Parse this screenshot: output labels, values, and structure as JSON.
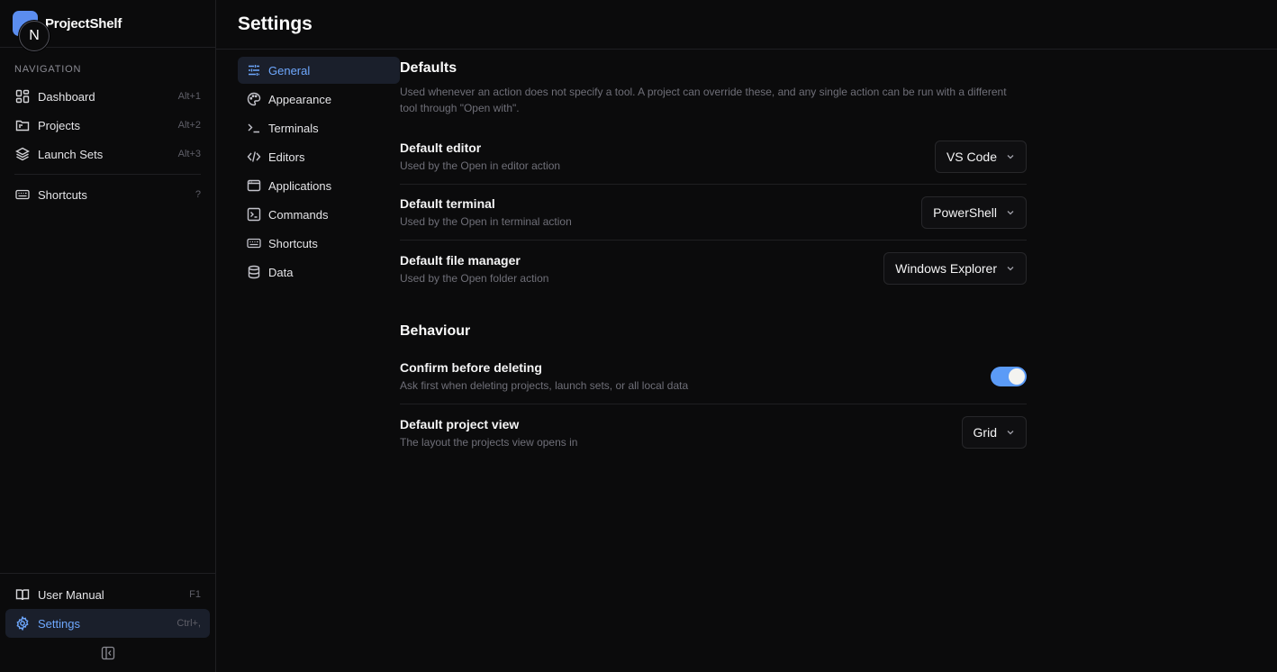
{
  "app": {
    "name": "ProjectShelf",
    "badge": "N"
  },
  "sidebar": {
    "section_label": "NAVIGATION",
    "items": [
      {
        "label": "Dashboard",
        "shortcut": "Alt+1",
        "icon": "dashboard-icon"
      },
      {
        "label": "Projects",
        "shortcut": "Alt+2",
        "icon": "folder-icon"
      },
      {
        "label": "Launch Sets",
        "shortcut": "Alt+3",
        "icon": "layers-icon"
      }
    ],
    "shortcuts_item": {
      "label": "Shortcuts",
      "shortcut": "?"
    },
    "bottom": {
      "manual": {
        "label": "User Manual",
        "shortcut": "F1"
      },
      "settings": {
        "label": "Settings",
        "shortcut": "Ctrl+,"
      }
    }
  },
  "page": {
    "title": "Settings"
  },
  "settings_nav": [
    {
      "label": "General",
      "active": true
    },
    {
      "label": "Appearance"
    },
    {
      "label": "Terminals"
    },
    {
      "label": "Editors"
    },
    {
      "label": "Applications"
    },
    {
      "label": "Commands"
    },
    {
      "label": "Shortcuts"
    },
    {
      "label": "Data"
    }
  ],
  "defaults": {
    "title": "Defaults",
    "description": "Used whenever an action does not specify a tool. A project can override these, and any single action can be run with a different tool through \"Open with\".",
    "rows": [
      {
        "title": "Default editor",
        "desc": "Used by the Open in editor action",
        "value": "VS Code"
      },
      {
        "title": "Default terminal",
        "desc": "Used by the Open in terminal action",
        "value": "PowerShell"
      },
      {
        "title": "Default file manager",
        "desc": "Used by the Open folder action",
        "value": "Windows Explorer"
      }
    ]
  },
  "behaviour": {
    "title": "Behaviour",
    "confirm": {
      "title": "Confirm before deleting",
      "desc": "Ask first when deleting projects, launch sets, or all local data",
      "enabled": true
    },
    "view": {
      "title": "Default project view",
      "desc": "The layout the projects view opens in",
      "value": "Grid"
    }
  },
  "colors": {
    "accent": "#6ea8fe",
    "toggle_on": "#5b9bf7",
    "background": "#0b0b0c"
  }
}
